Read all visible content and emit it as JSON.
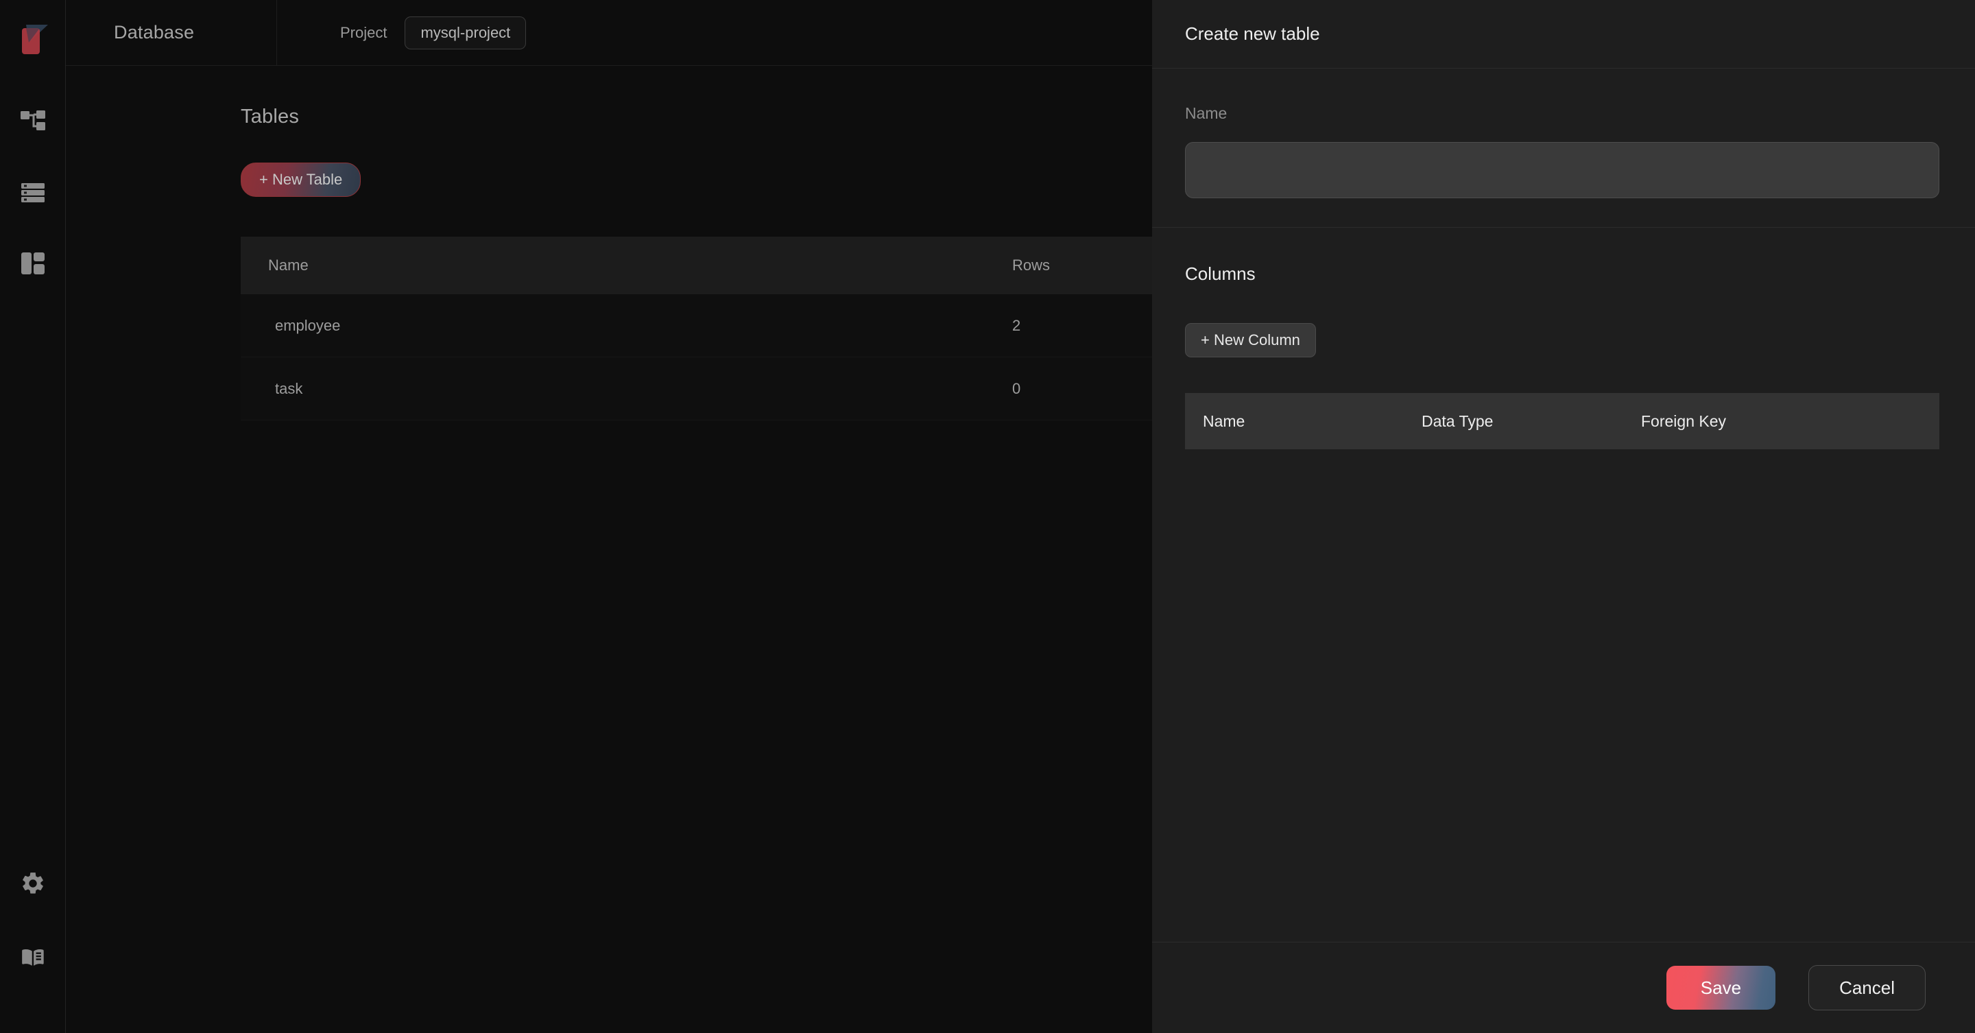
{
  "app": {
    "logo_name": "app-logo",
    "accent_red": "#b03a42",
    "accent_navy": "#2c3b4d",
    "panel_bg": "#1e1e1e",
    "app_bg": "#0d0d0d"
  },
  "rail": {
    "items": [
      {
        "icon": "schema-hierarchy-icon",
        "label": "Schema"
      },
      {
        "icon": "database-list-icon",
        "label": "Data"
      },
      {
        "icon": "dashboard-layout-icon",
        "label": "Layout"
      }
    ],
    "bottom_items": [
      {
        "icon": "gear-icon",
        "label": "Settings"
      },
      {
        "icon": "book-icon",
        "label": "Docs"
      }
    ]
  },
  "topbar": {
    "title": "Database",
    "project_label": "Project",
    "project_name": "mysql-project"
  },
  "tables_section": {
    "heading": "Tables",
    "new_table_label": "+ New Table",
    "columns": [
      "Name",
      "Rows"
    ],
    "rows": [
      {
        "name": "employee",
        "rows": "2"
      },
      {
        "name": "task",
        "rows": "0"
      }
    ]
  },
  "panel": {
    "title": "Create new table",
    "name_label": "Name",
    "name_value": "",
    "name_placeholder": "",
    "columns_title": "Columns",
    "new_column_label": "+ New Column",
    "columns_table_headers": [
      "Name",
      "Data Type",
      "Foreign Key"
    ],
    "columns_rows": [],
    "save_label": "Save",
    "cancel_label": "Cancel"
  }
}
